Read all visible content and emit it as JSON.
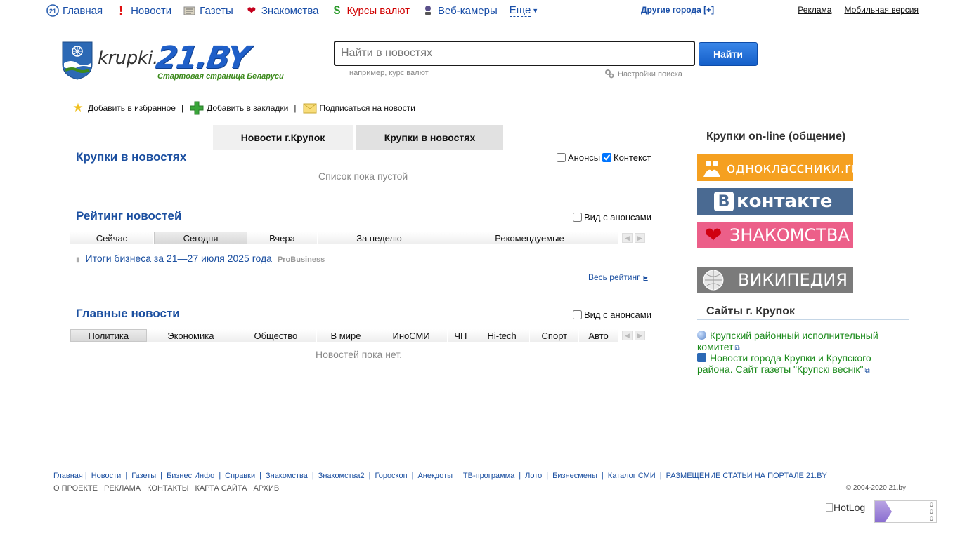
{
  "topnav": {
    "items": [
      {
        "label": "Главная",
        "icon": "home-icon"
      },
      {
        "label": "Новости",
        "icon": "exclamation-icon"
      },
      {
        "label": "Газеты",
        "icon": "newspaper-icon"
      },
      {
        "label": "Знакомства",
        "icon": "heart-icon"
      },
      {
        "label": "Курсы валют",
        "icon": "dollar-icon"
      },
      {
        "label": "Веб-камеры",
        "icon": "webcam-icon"
      }
    ],
    "more": "Еще",
    "other_cities": "Другие города [+]",
    "ads": "Реклама",
    "mobile": "Мобильная версия"
  },
  "logo": {
    "city": "krupki.",
    "brand": "21.BY",
    "tagline": "Стартовая страница Беларуси"
  },
  "search": {
    "placeholder": "Найти в новостях",
    "button": "Найти",
    "hint": "например, курс валют",
    "settings": "Настройки поиска"
  },
  "bookmarks": {
    "favorites": "Добавить в избранное",
    "bookmarks": "Добавить в закладки",
    "subscribe": "Подписаться на новости"
  },
  "tabs": {
    "city_news": "Новости г.Крупок",
    "in_news": "Крупки в новостях"
  },
  "in_news": {
    "title": "Крупки в новостях",
    "announces": "Анонсы",
    "context": "Контекст",
    "empty": "Список пока пустой"
  },
  "rating": {
    "title": "Рейтинг новостей",
    "with_announces": "Вид с анонсами",
    "filters": [
      "Сейчас",
      "Сегодня",
      "Вчера",
      "За неделю",
      "Рекомендуемые"
    ],
    "item_title": "Итоги бизнеса за 21—27 июля 2025 года",
    "item_source": "ProBusiness",
    "all": "Весь рейтинг"
  },
  "main_news": {
    "title": "Главные новости",
    "with_announces": "Вид с анонсами",
    "filters": [
      "Политика",
      "Экономика",
      "Общество",
      "В мире",
      "ИноСМИ",
      "ЧП",
      "Hi-tech",
      "Спорт",
      "Авто"
    ],
    "empty": "Новостей пока нет."
  },
  "sidebar": {
    "online_title": "Крупки on-line (общение)",
    "banners": {
      "ok": "одноклассники.ru",
      "vk": "контакте",
      "vk_letter": "B",
      "dating": "ЗНАКОМСТВА",
      "wiki": "ВИКИПЕДИЯ"
    },
    "sites_title": "Сайты г. Крупок",
    "sites": [
      "Крупский районный исполнительный комитет",
      "Новости города Крупки и Крупского района. Сайт газеты \"Крупскі веснік\""
    ]
  },
  "footer": {
    "links": [
      "Главная",
      "Новости",
      "Газеты",
      "Бизнес Инфо",
      "Справки",
      "Знакомства",
      "Знакомства2",
      "Гороскоп",
      "Анекдоты",
      "ТВ-программа",
      "Лото",
      "Бизнесмены",
      "Каталог СМИ",
      "РАЗМЕЩЕНИЕ СТАТЬИ НА ПОРТАЛЕ 21.BY"
    ],
    "links2": [
      "О ПРОЕКТЕ",
      "РЕКЛАМА",
      "КОНТАКТЫ",
      "КАРТА САЙТА",
      "АРХИВ"
    ],
    "copyright": "© 2004-2020 21.by",
    "hotlog": "HotLog",
    "counter_values": [
      "0",
      "0",
      "0"
    ]
  },
  "colors": {
    "link": "#1b4fa0",
    "nav_link": "#1a4fa8",
    "red_nav": "#d00000",
    "site_link": "#1a8a1a",
    "search_button": "#1d6ad6"
  }
}
